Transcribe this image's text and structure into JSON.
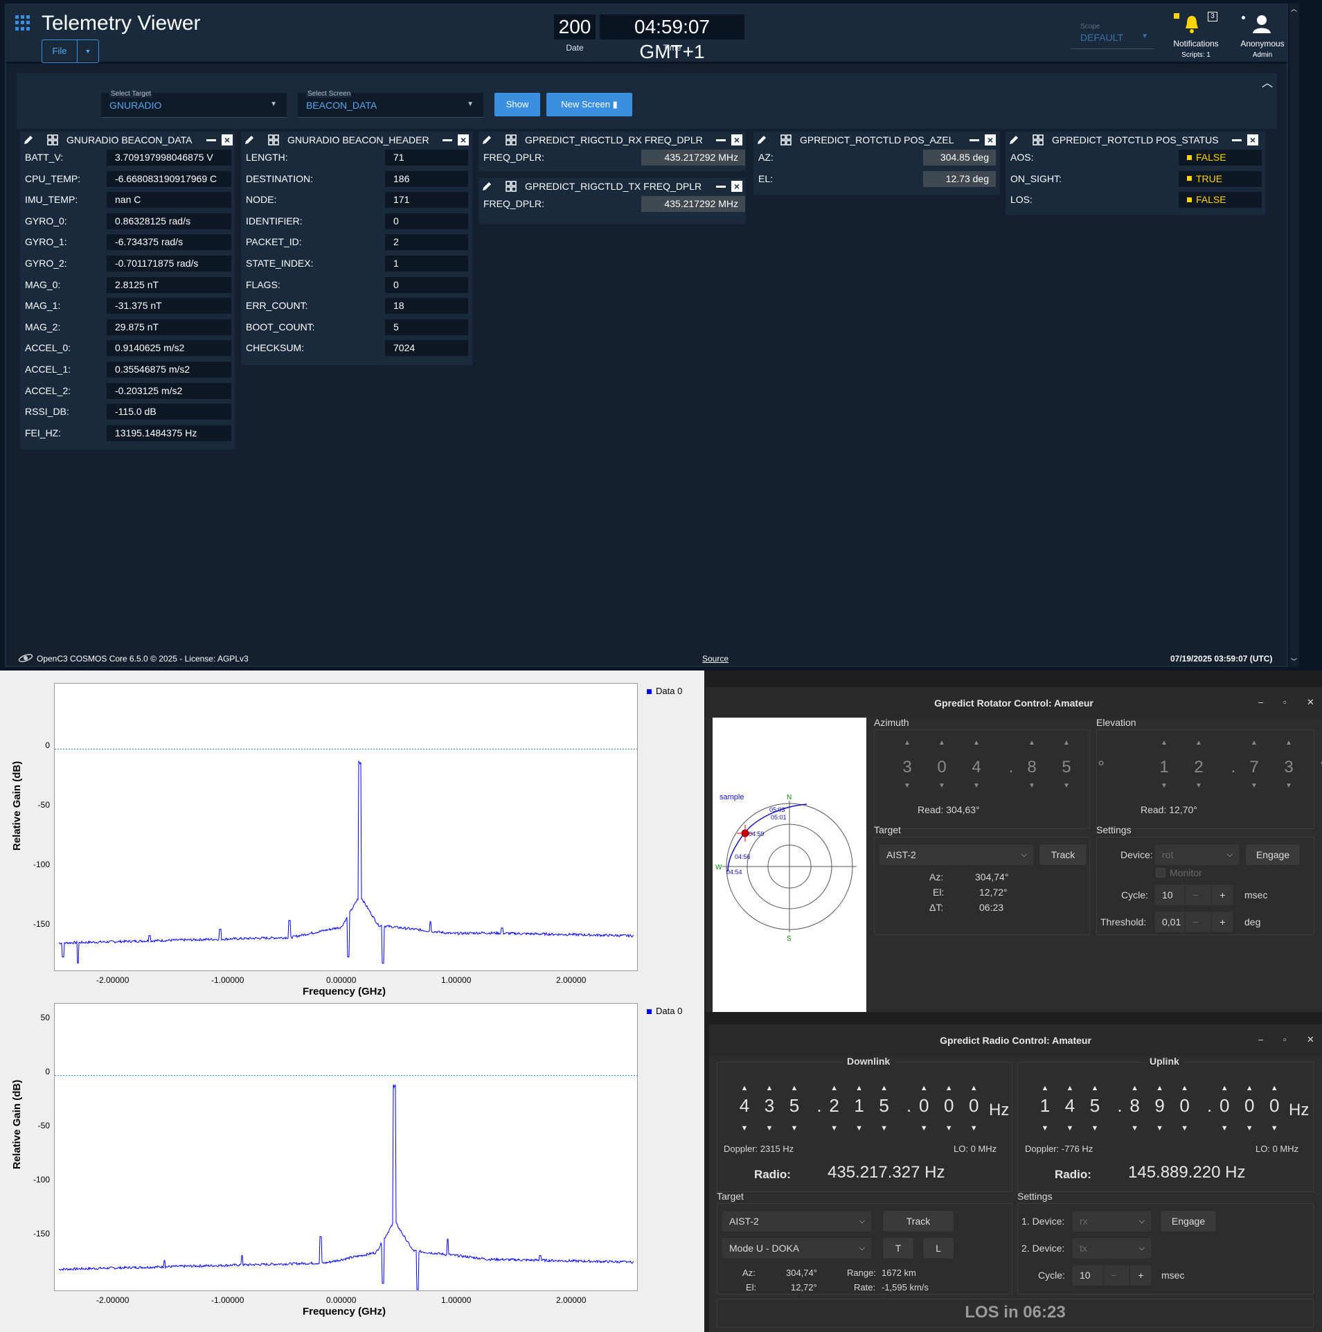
{
  "cosmos": {
    "app_title": "Telemetry Viewer",
    "file_label": "File",
    "file_dropdown_icon": "chevron-down-icon",
    "date_value": "200",
    "time_value": "04:59:07 GMT+1",
    "date_label": "Date",
    "time_label": "Time",
    "scope_label": "Scope",
    "scope_value": "DEFAULT",
    "notifications_label": "Notifications",
    "notifications_count": "3",
    "scripts_label": "Scripts: 1",
    "user_label": "Anonymous",
    "user_role": "Admin",
    "select_target_label": "Select Target",
    "select_target_value": "GNURADIO",
    "select_screen_label": "Select Screen",
    "select_screen_value": "BEACON_DATA",
    "show_button": "Show",
    "new_screen_button": "New Screen",
    "footer_left": "OpenC3 COSMOS Core 6.5.0 © 2025 - License: AGPLv3",
    "footer_source": "Source",
    "footer_right": "07/19/2025 03:59:07 (UTC)",
    "colors": {
      "accent": "#3b8fe0",
      "bg": "#14202f",
      "panel": "#1a2a3d",
      "yellow": "#ffd400"
    }
  },
  "panels": {
    "beacon_data": {
      "title": "GNURADIO BEACON_DATA",
      "rows": [
        {
          "label": "BATT_V:",
          "value": "3.709197998046875 V"
        },
        {
          "label": "CPU_TEMP:",
          "value": "-6.668083190917969 C"
        },
        {
          "label": "IMU_TEMP:",
          "value": "nan C"
        },
        {
          "label": "GYRO_0:",
          "value": "0.86328125 rad/s"
        },
        {
          "label": "GYRO_1:",
          "value": "-6.734375 rad/s"
        },
        {
          "label": "GYRO_2:",
          "value": "-0.701171875 rad/s"
        },
        {
          "label": "MAG_0:",
          "value": "2.8125 nT"
        },
        {
          "label": "MAG_1:",
          "value": "-31.375 nT"
        },
        {
          "label": "MAG_2:",
          "value": "29.875 nT"
        },
        {
          "label": "ACCEL_0:",
          "value": "0.9140625 m/s2"
        },
        {
          "label": "ACCEL_1:",
          "value": "0.35546875 m/s2"
        },
        {
          "label": "ACCEL_2:",
          "value": "-0.203125 m/s2"
        },
        {
          "label": "RSSI_DB:",
          "value": "-115.0 dB"
        },
        {
          "label": "FEI_HZ:",
          "value": "13195.1484375 Hz"
        }
      ]
    },
    "beacon_header": {
      "title": "GNURADIO BEACON_HEADER",
      "rows": [
        {
          "label": "LENGTH:",
          "value": "71"
        },
        {
          "label": "DESTINATION:",
          "value": "186"
        },
        {
          "label": "NODE:",
          "value": "171"
        },
        {
          "label": "IDENTIFIER:",
          "value": "0"
        },
        {
          "label": "PACKET_ID:",
          "value": "2"
        },
        {
          "label": "STATE_INDEX:",
          "value": "1"
        },
        {
          "label": "FLAGS:",
          "value": "0"
        },
        {
          "label": "ERR_COUNT:",
          "value": "18"
        },
        {
          "label": "BOOT_COUNT:",
          "value": "5"
        },
        {
          "label": "CHECKSUM:",
          "value": "7024"
        }
      ]
    },
    "rx_freq": {
      "title": "GPREDICT_RIGCTLD_RX FREQ_DPLR",
      "label": "FREQ_DPLR:",
      "value": "435.217292 MHz"
    },
    "tx_freq": {
      "title": "GPREDICT_RIGCTLD_TX FREQ_DPLR",
      "label": "FREQ_DPLR:",
      "value": "435.217292 MHz"
    },
    "pos_azel": {
      "title": "GPREDICT_ROTCTLD POS_AZEL",
      "rows": [
        {
          "label": "AZ:",
          "value": "304.85 deg"
        },
        {
          "label": "EL:",
          "value": "12.73 deg"
        }
      ]
    },
    "pos_status": {
      "title": "GPREDICT_ROTCTLD POS_STATUS",
      "rows": [
        {
          "label": "AOS:",
          "value": "FALSE"
        },
        {
          "label": "ON_SIGHT:",
          "value": "TRUE"
        },
        {
          "label": "LOS:",
          "value": "FALSE"
        }
      ]
    }
  },
  "gnuradio": {
    "legend": "Data 0",
    "plot1": {
      "ylabel": "Relative Gain (dB)",
      "xlabel": "Frequency (GHz)",
      "yticks": [
        "0",
        "-50",
        "-100",
        "-150"
      ],
      "xticks": [
        "-2.00000",
        "-1.00000",
        "0.00000",
        "1.00000",
        "2.00000"
      ]
    },
    "plot2": {
      "ylabel": "Relative Gain (dB)",
      "xlabel": "Frequency (GHz)",
      "yticks": [
        "50",
        "0",
        "-50",
        "-100",
        "-150"
      ],
      "xticks": [
        "-2.00000",
        "-1.00000",
        "0.00000",
        "1.00000",
        "2.00000"
      ]
    },
    "trace_color": "#0000ff"
  },
  "rotator": {
    "title": "Gpredict Rotator Control: Amateur",
    "polar": {
      "sat_label": "sample",
      "n": "N",
      "s": "S",
      "w": "W",
      "times": [
        "05:03",
        "05:01",
        "04:59",
        "04:56",
        "04:54"
      ]
    },
    "azimuth_label": "Azimuth",
    "azimuth_digits": [
      "3",
      "0",
      "4",
      ".",
      "8",
      "5",
      "°"
    ],
    "azimuth_read": "Read: 304,63°",
    "elevation_label": "Elevation",
    "elevation_digits": [
      "1",
      "2",
      ".",
      "7",
      "3",
      "°"
    ],
    "elevation_read": "Read: 12,70°",
    "target_label": "Target",
    "target_value": "AIST-2",
    "track_button": "Track",
    "az_label": "Az:",
    "az_value": "304,74°",
    "el_label": "El:",
    "el_value": "12,72°",
    "dt_label": "ΔT:",
    "dt_value": "06:23",
    "settings_label": "Settings",
    "device_label": "Device:",
    "device_value": "rot",
    "engage_button": "Engage",
    "monitor_label": "Monitor",
    "cycle_label": "Cycle:",
    "cycle_value": "10",
    "cycle_unit": "msec",
    "threshold_label": "Threshold:",
    "threshold_value": "0,01",
    "threshold_unit": "deg"
  },
  "radio": {
    "title": "Gpredict Radio Control: Amateur",
    "downlink_label": "Downlink",
    "downlink_digits": [
      "4",
      "3",
      "5",
      ".",
      "2",
      "1",
      "5",
      ".",
      "0",
      "0",
      "0"
    ],
    "hz": "Hz",
    "downlink_doppler": "Doppler: 2315 Hz",
    "downlink_lo": "LO: 0 MHz",
    "radio_label": "Radio:",
    "downlink_radio": "435.217.327 Hz",
    "uplink_label": "Uplink",
    "uplink_digits": [
      "1",
      "4",
      "5",
      ".",
      "8",
      "9",
      "0",
      ".",
      "0",
      "0",
      "0"
    ],
    "uplink_doppler": "Doppler: -776 Hz",
    "uplink_lo": "LO: 0 MHz",
    "uplink_radio": "145.889.220 Hz",
    "target_label": "Target",
    "target_value": "AIST-2",
    "track_button": "Track",
    "mode_value": "Mode U - DOKA",
    "t_button": "T",
    "l_button": "L",
    "az_label": "Az:",
    "az_value": "304,74°",
    "el_label": "El:",
    "el_value": "12,72°",
    "range_label": "Range:",
    "range_value": "1672 km",
    "rate_label": "Rate:",
    "rate_value": "-1,595 km/s",
    "settings_label": "Settings",
    "device1_label": "1. Device:",
    "device1_value": "rx",
    "device2_label": "2. Device:",
    "device2_value": "tx",
    "engage_button": "Engage",
    "cycle_label": "Cycle:",
    "cycle_value": "10",
    "cycle_unit": "msec",
    "los_text": "LOS in 06:23"
  }
}
